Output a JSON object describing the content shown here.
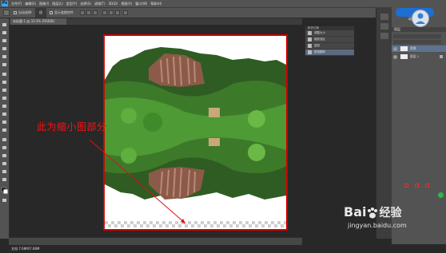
{
  "app": {
    "logo": "Ps"
  },
  "menus": [
    "文件(F)",
    "编辑(E)",
    "图像(I)",
    "图层(L)",
    "类型(Y)",
    "选择(S)",
    "滤镜(T)",
    "3D(D)",
    "视图(V)",
    "窗口(W)",
    "帮助(H)"
  ],
  "options": {
    "auto_select_label": "自动选择:",
    "auto_select_value": "组",
    "transform_label": "显示变换控件"
  },
  "document": {
    "tab_label": "未标题-1 @ 33.3% (RGB/8)"
  },
  "floating_panel": {
    "title": "历史记录",
    "items": [
      "调整大小",
      "缩放选区",
      "复制",
      "垂直翻转"
    ],
    "selected_index": 3
  },
  "panels": {
    "badge_label": "动画工具",
    "layers_title": "图层",
    "layers": [
      {
        "name": "背景",
        "active": true
      },
      {
        "name": "图层 1",
        "active": false
      }
    ]
  },
  "canvas": {
    "annotation": "此为缩小图部分"
  },
  "status": {
    "text": "文档:7.68M/7.68M"
  },
  "watermark": {
    "brand": "Bai",
    "brand_suffix": "经验",
    "url": "jingyan.baidu.com"
  },
  "colors": {
    "annotation_red": "#ff1010",
    "frame_red": "#d00000",
    "accent_blue": "#1f6fd0"
  }
}
